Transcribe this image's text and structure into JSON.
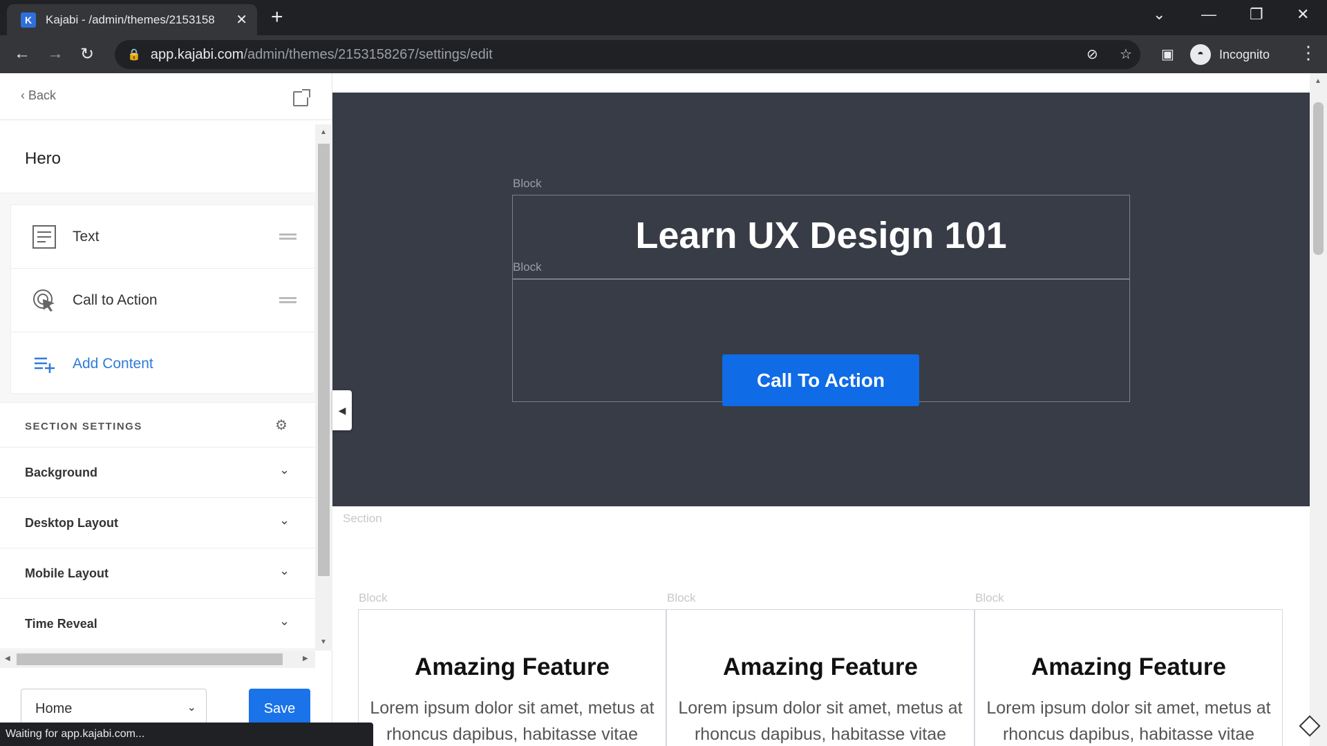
{
  "browser": {
    "tab_title": "Kajabi - /admin/themes/2153158",
    "favicon_letter": "K",
    "url_host": "app.kajabi.com",
    "url_path": "/admin/themes/2153158267/settings/edit",
    "incognito_label": "Incognito",
    "status_text": "Waiting for app.kajabi.com..."
  },
  "sidebar": {
    "back_label": "Back",
    "section_title": "Hero",
    "blocks": [
      {
        "label": "Text",
        "icon": "text-block-icon"
      },
      {
        "label": "Call to Action",
        "icon": "cursor-click-icon"
      }
    ],
    "add_content_label": "Add Content",
    "section_settings_label": "SECTION SETTINGS",
    "settings": [
      {
        "label": "Background"
      },
      {
        "label": "Desktop Layout"
      },
      {
        "label": "Mobile Layout"
      },
      {
        "label": "Time Reveal"
      }
    ],
    "page_select_value": "Home",
    "save_label": "Save"
  },
  "preview": {
    "block_label": "Block",
    "section_label": "Section",
    "hero_heading": "Learn UX Design 101",
    "cta_label": "Call To Action",
    "features": [
      {
        "title": "Amazing Feature",
        "text": "Lorem ipsum dolor sit amet, metus at rhoncus dapibus, habitasse vitae"
      },
      {
        "title": "Amazing Feature",
        "text": "Lorem ipsum dolor sit amet, metus at rhoncus dapibus, habitasse vitae"
      },
      {
        "title": "Amazing Feature",
        "text": "Lorem ipsum dolor sit amet, metus at rhoncus dapibus, habitasse vitae"
      }
    ]
  },
  "colors": {
    "accent": "#1a73e8",
    "hero_bg": "#383c46",
    "cta_bg": "#0f6be6"
  }
}
